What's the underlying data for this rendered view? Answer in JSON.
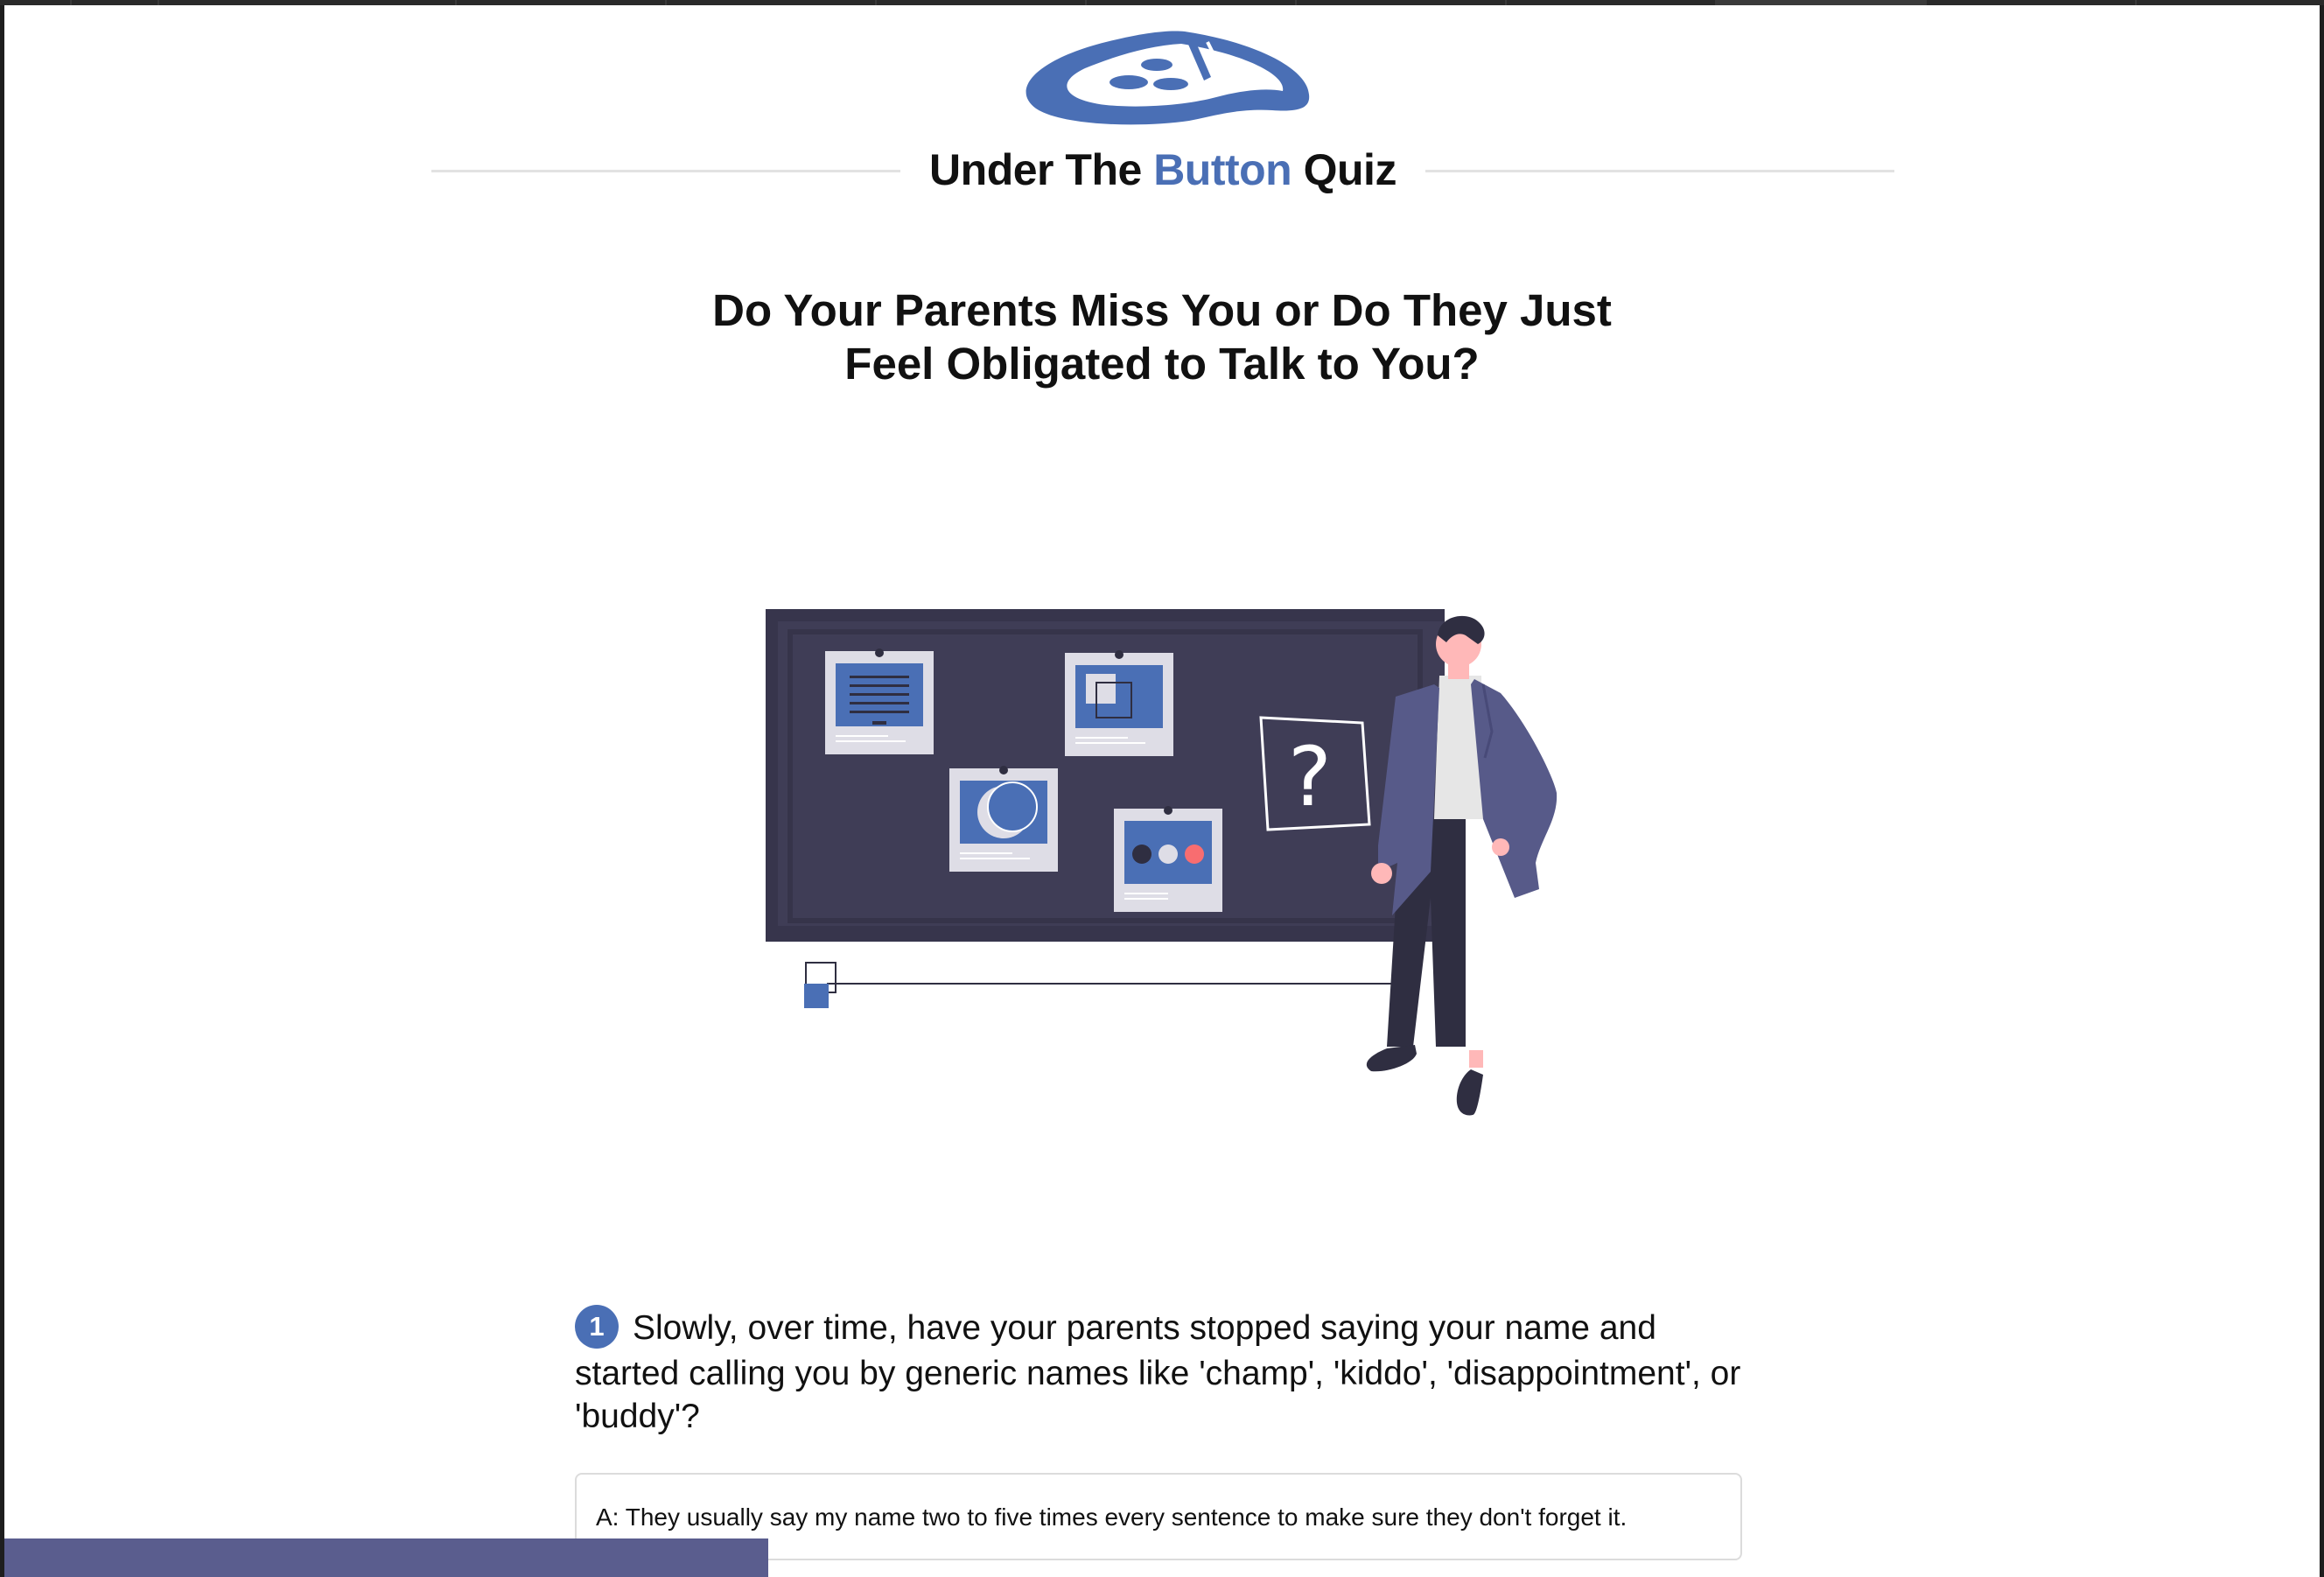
{
  "header": {
    "brand_prefix": "Under The ",
    "brand_accent": "Button",
    "brand_suffix": " Quiz",
    "logo_icon": "pizza-slice-logo-icon"
  },
  "quiz": {
    "title_line1": "Do Your Parents Miss You or Do They Just",
    "title_line2": "Feel Obligated to Talk to You?"
  },
  "illustration": {
    "icon": "person-at-board-illustration",
    "question_mark": "?"
  },
  "question": {
    "number": "1",
    "text": "Slowly, over time, have your parents stopped saying your name and started calling you by generic names like 'champ', 'kiddo', 'disappointment', or 'buddy'?"
  },
  "answers": [
    {
      "label": "A: They usually say my name two to five times every sentence to make sure they don't forget it."
    }
  ],
  "progress": {
    "fraction": 0.33
  },
  "colors": {
    "accent": "#4a6fb5",
    "board": "#3f3d56",
    "progress": "#5a5d8e",
    "pink": "#f86d70"
  }
}
